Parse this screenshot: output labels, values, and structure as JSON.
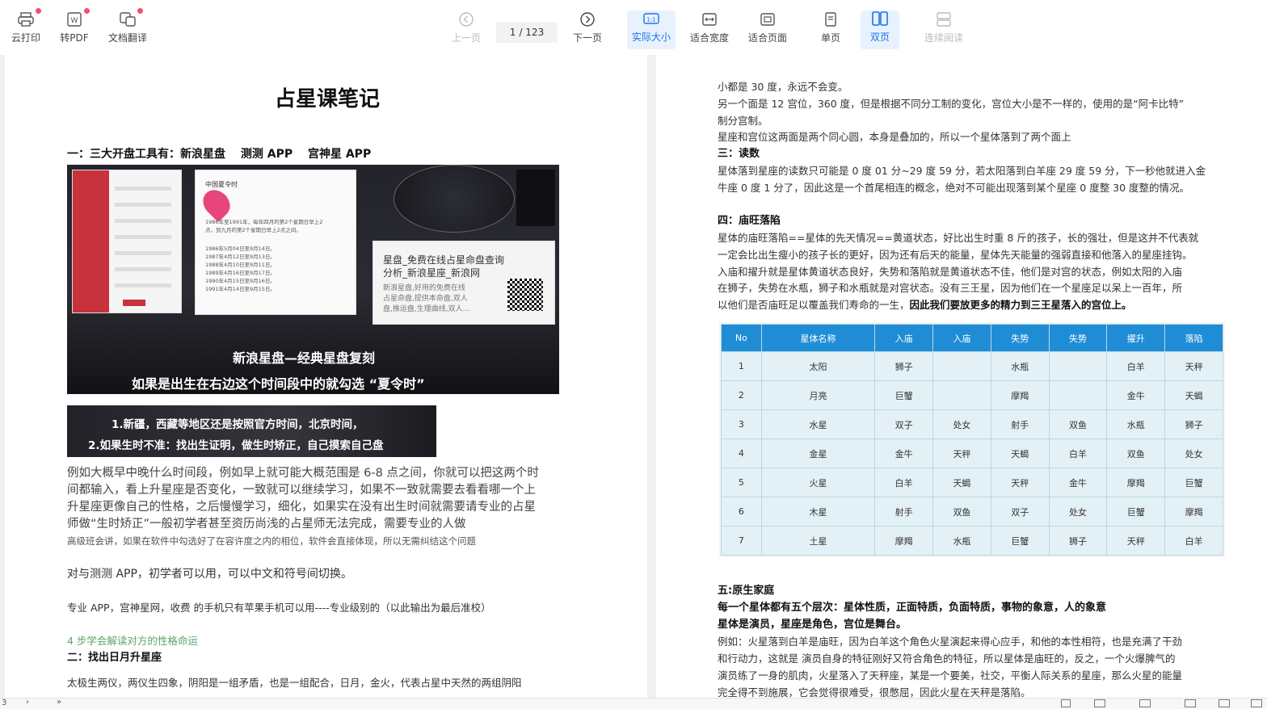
{
  "toolbar": {
    "cloud_print": "云打印",
    "to_pdf": "转PDF",
    "doc_translate": "文档翻译",
    "prev_page": "上一页",
    "current_page": "1",
    "total_pages": "/ 123",
    "next_page": "下一页",
    "actual_size": "实际大小",
    "fit_width": "适合宽度",
    "fit_page": "适合页面",
    "single_page": "单页",
    "double_page": "双页",
    "continuous": "连续阅读"
  },
  "left_page": {
    "title": "占星课笔记",
    "section1": "一：三大开盘工具有：新浪星盘　 测测 APP　 宫神星 APP",
    "image1": {
      "card_title": "中国夏令时",
      "card_text1": "1986年至1991年，每年四月的第2个星期日早上2",
      "card_text2": "点，到九月的第2个星期日早上2点之间。",
      "card_list": [
        "1986年5月04日至9月14日。",
        "1987年4月12日至9月13日。",
        "1988年4月10日至9月11日。",
        "1989年4月16日至9月17日。",
        "1990年4月15日至9月16日。",
        "1991年4月14日至9月15日。"
      ],
      "popup_title1": "星盘_免费在线占星命盘查询",
      "popup_title2": "分析_新浪星座_新浪网",
      "popup_desc1": "新浪星盘,好用的免费在线",
      "popup_desc2": "占星命盘,提供本命盘,双人",
      "popup_desc3": "盘,推运盘,生理曲线,双人...",
      "caption1": "新浪星盘—经典星盘复刻",
      "caption2": "如果是出生在右边这个时间段中的就勾选 “夏令时”"
    },
    "image2": {
      "line1": "1.新疆，西藏等地区还是按照官方时间，北京时间，",
      "line2": "2.如果生时不准：找出生证明，做生时矫正，自己摸索自己盘"
    },
    "para1": [
      "例如大概早中晚什么时间段，例如早上就可能大概范围是 6-8 点之间，你就可以把这两个时",
      "间都输入，看上升星座是否变化，一致就可以继续学习，如果不一致就需要去看看哪一个上",
      "升星座更像自己的性格，之后慢慢学习，细化，如果实在没有出生时间就需要请专业的占星",
      "师做“生时矫正”一般初学者甚至资历尚浅的占星师无法完成，需要专业的人做"
    ],
    "note1": "高级班会讲，如果在软件中勾选好了在容许度之内的相位，软件会直接体现，所以无需纠结这个问题",
    "para2": "对与测测 APP，初学者可以用，可以中文和符号间切换。",
    "para3": "专业 APP，宫神星网，收费 的手机只有苹果手机可以用----专业级别的（以此输出为最后准校）",
    "green_note": "4 步学会解读对方的性格命运",
    "section2": "二：找出日月升星座",
    "para4": "太极生两仪，两仪生四象，阴阳是一组矛盾，也是一组配合，日月，金火，代表占星中天然的两组阴阳"
  },
  "right_page": {
    "lines_top": [
      "小都是 30 度，永远不会变。",
      "另一个面是 12 宫位，360 度，但是根据不同分工制的变化，宫位大小是不一样的，使用的是“阿卡比特”",
      "制分宫制。",
      "星座和宫位这两面是两个同心圆，本身是叠加的，所以一个星体落到了两个面上"
    ],
    "section3": "三：读数",
    "lines_read": [
      "星体落到星座的读数只可能是  0 度 01 分~29 度 59 分，若太阳落到白羊座 29 度 59 分，下一秒他就进入金",
      "牛座 0 度 1 分了，因此这是一个首尾相连的概念，绝对不可能出现落到某个星座 0 度整 30 度整的情况。"
    ],
    "section4": "四：庙旺落陷",
    "lines_ruling": [
      "星体的庙旺落陷==星体的先天情况==黄道状态，好比出生时重 8 斤的孩子，长的强壮，但是这并不代表就",
      "一定会比出生瘦小的孩子长的更好，因为还有后天的能量，星体先天能量的强弱直接和他落入的星座挂钩。",
      "入庙和擢升就是星体黄道状态良好，失势和落陷就是黄道状态不佳，他们是对宫的状态，例如太阳的入庙",
      "在狮子，失势在水瓶，狮子和水瓶就是对宫状态。没有三王星，因为他们在一个星座足以呆上一百年，所",
      "以他们是否庙旺足以覆盖我们寿命的一生，"
    ],
    "ruling_bold": "因此我们要放更多的精力到三王星落入的宫位上。",
    "table": {
      "headers": [
        "No",
        "星体名称",
        "入庙",
        "入庙",
        "失势",
        "失势",
        "擢升",
        "落陷"
      ],
      "rows": [
        [
          "1",
          "太阳",
          "狮子",
          "",
          "水瓶",
          "",
          "白羊",
          "天秤"
        ],
        [
          "2",
          "月亮",
          "巨蟹",
          "",
          "摩羯",
          "",
          "金牛",
          "天蝎"
        ],
        [
          "3",
          "水星",
          "双子",
          "处女",
          "射手",
          "双鱼",
          "水瓶",
          "狮子"
        ],
        [
          "4",
          "金星",
          "金牛",
          "天秤",
          "天蝎",
          "白羊",
          "双鱼",
          "处女"
        ],
        [
          "5",
          "火星",
          "白羊",
          "天蝎",
          "天秤",
          "金牛",
          "摩羯",
          "巨蟹"
        ],
        [
          "6",
          "木星",
          "射手",
          "双鱼",
          "双子",
          "处女",
          "巨蟹",
          "摩羯"
        ],
        [
          "7",
          "土星",
          "摩羯",
          "水瓶",
          "巨蟹",
          "狮子",
          "天秤",
          "白羊"
        ]
      ]
    },
    "section5": "五:原生家庭",
    "bold1": "每一个星体都有五个层次：星体性质，正面特质，负面特质，事物的象意，人的象意",
    "bold2": "星体是演员，星座是角色，宫位是舞台。",
    "lines_example": [
      "例如：火星落到白羊是庙旺，因为白羊这个角色火星演起来得心应手，和他的本性相符，也是充满了干劲",
      "和行动力，这就是 演员自身的特征刚好又符合角色的特征，所以星体是庙旺的，反之，一个火爆脾气的",
      "演员练了一身的肌肉，火星落入了天秤座，某是一个要美，社交，平衡人际关系的星座，那么火星的能量",
      "完全得不到施展，它会觉得很难受，很憋屈，因此火星在天秤是落陷。"
    ]
  },
  "bottombar": {
    "page_indicator": "3"
  }
}
